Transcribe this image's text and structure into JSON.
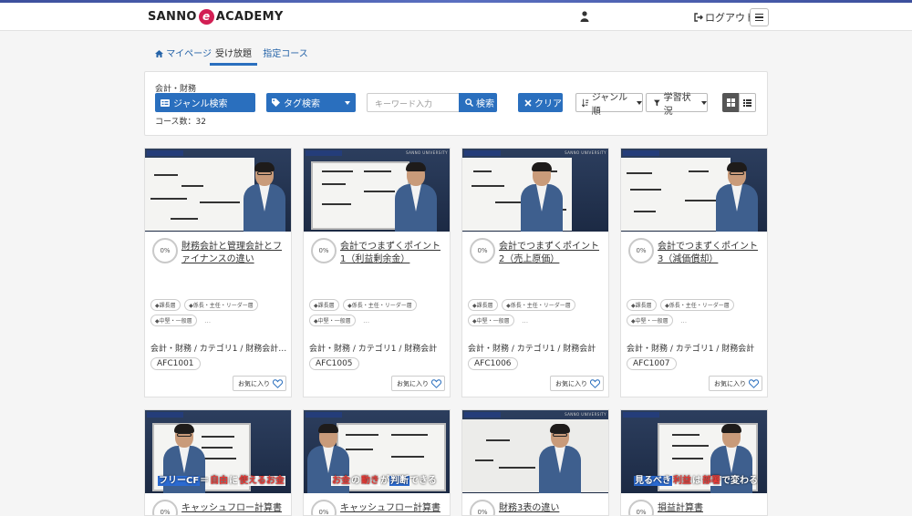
{
  "header": {
    "logo_left": "SANNO",
    "logo_e": "e",
    "logo_right": "ACADEMY",
    "user_icon": "user-icon",
    "logout_label": "ログアウト",
    "menu_icon": "hamburger-icon"
  },
  "tabs": [
    {
      "label": "マイページ",
      "icon": "home-icon",
      "active": false
    },
    {
      "label": "受け放題",
      "active": true
    },
    {
      "label": "指定コース",
      "active": false
    }
  ],
  "filters": {
    "category_label": "会計・財務",
    "genre_button": "ジャンル検索",
    "tag_button": "タグ検索",
    "keyword_placeholder": "キーワード入力",
    "search_button": "検索",
    "clear_button": "クリア",
    "sort_button": "ジャンル順",
    "status_button": "学習状況",
    "course_count": "コース数：32",
    "accent_color": "#2a6fbe"
  },
  "courses": [
    {
      "progress": "0%",
      "title": "財務会計と管理会計とファイナンスの違い",
      "tags": [
        "課長層",
        "係長・主任・リーダー層",
        "中堅・一般層"
      ],
      "more": "…",
      "path": "会計・財務 / カテゴリ1 / 財務会計…",
      "code": "AFC1001",
      "fav_label": "お気に入り"
    },
    {
      "progress": "0%",
      "title": "会計でつまずくポイント1（利益剰余金）",
      "tags": [
        "課長層",
        "係長・主任・リーダー層",
        "中堅・一般層"
      ],
      "more": "…",
      "path": "会計・財務 / カテゴリ1 / 財務会計",
      "code": "AFC1005",
      "fav_label": "お気に入り"
    },
    {
      "progress": "0%",
      "title": "会計でつまずくポイント2（売上原価）",
      "tags": [
        "課長層",
        "係長・主任・リーダー層",
        "中堅・一般層"
      ],
      "more": "…",
      "path": "会計・財務 / カテゴリ1 / 財務会計",
      "code": "AFC1006",
      "fav_label": "お気に入り"
    },
    {
      "progress": "0%",
      "title": "会計でつまずくポイント3（減価償却）",
      "tags": [
        "課長層",
        "係長・主任・リーダー層",
        "中堅・一般層"
      ],
      "more": "…",
      "path": "会計・財務 / カテゴリ1 / 財務会計",
      "code": "AFC1007",
      "fav_label": "お気に入り"
    },
    {
      "progress": "0%",
      "title": "キャッシュフロー計算書",
      "caption": {
        "a": "フリーCF",
        "b": "＝",
        "c": "自由",
        "d": "に",
        "e": "使えるお金"
      }
    },
    {
      "progress": "0%",
      "title": "キャッシュフロー計算書",
      "caption": {
        "a": "お金",
        "b": "の",
        "c": "動き",
        "d": "が",
        "e": "判断",
        "f": "できる"
      }
    },
    {
      "progress": "0%",
      "title": "財務3表の違い"
    },
    {
      "progress": "0%",
      "title": "損益計算書",
      "caption": {
        "a": "見るべき",
        "b": "利益",
        "c": "は",
        "d": "部署",
        "e": "で変わる"
      }
    }
  ],
  "thumb_brand": "SANNO UNIVERSITY",
  "icons": {
    "search": "search-icon",
    "tag": "tag-icon",
    "genre": "list-icon",
    "clear": "close-icon",
    "sort": "sort-icon",
    "filter": "filter-icon",
    "grid": "grid-view-icon",
    "list": "list-view-icon",
    "heart": "heart-icon"
  }
}
